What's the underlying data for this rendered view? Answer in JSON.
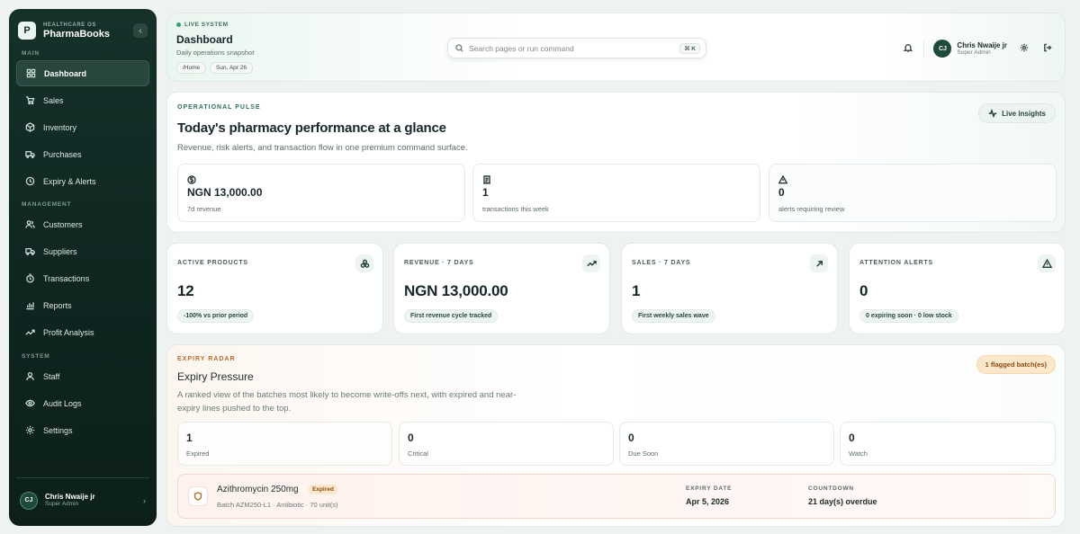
{
  "brand": {
    "sub": "HEALTHCARE OS",
    "name": "PharmaBooks",
    "logo": "P"
  },
  "sidebar": {
    "sections": {
      "main": "MAIN",
      "management": "MANAGEMENT",
      "system": "SYSTEM"
    },
    "items": [
      {
        "label": "Dashboard",
        "icon": "grid-icon",
        "active": true
      },
      {
        "label": "Sales",
        "icon": "cart-icon"
      },
      {
        "label": "Inventory",
        "icon": "box-icon"
      },
      {
        "label": "Purchases",
        "icon": "truck-icon"
      },
      {
        "label": "Expiry & Alerts",
        "icon": "clock-icon"
      },
      {
        "label": "Customers",
        "icon": "users-icon"
      },
      {
        "label": "Suppliers",
        "icon": "truck-icon"
      },
      {
        "label": "Transactions",
        "icon": "timer-icon"
      },
      {
        "label": "Reports",
        "icon": "bar-chart-icon"
      },
      {
        "label": "Profit Analysis",
        "icon": "trend-icon"
      },
      {
        "label": "Staff",
        "icon": "user-group-icon"
      },
      {
        "label": "Audit Logs",
        "icon": "eye-icon"
      },
      {
        "label": "Settings",
        "icon": "gear-icon"
      }
    ],
    "user": {
      "initials": "CJ",
      "name": "Chris Nwaije jr",
      "role": "Super Admin"
    }
  },
  "header": {
    "live": "LIVE SYSTEM",
    "title": "Dashboard",
    "subtitle": "Daily operations snapshot",
    "chips": [
      "/Home",
      "Sun, Apr 26"
    ],
    "search_placeholder": "Search pages or run command",
    "shortcut": "⌘ K",
    "user": {
      "initials": "CJ",
      "name": "Chris Nwaije jr",
      "role": "Super Admin"
    }
  },
  "pulse": {
    "eyebrow": "OPERATIONAL PULSE",
    "title": "Today's pharmacy performance at a glance",
    "subtitle": "Revenue, risk alerts, and transaction flow in one premium command surface.",
    "insights_label": "Live insights",
    "metrics": [
      {
        "value": "NGN 13,000.00",
        "label": "7d revenue",
        "icon": "coin-icon"
      },
      {
        "value": "1",
        "label": "transactions this week",
        "icon": "receipt-icon"
      },
      {
        "value": "0",
        "label": "alerts requiring review",
        "icon": "warning-icon"
      }
    ]
  },
  "stats": [
    {
      "label": "ACTIVE PRODUCTS",
      "value": "12",
      "note": "-100% vs prior period",
      "icon": "cubes-icon"
    },
    {
      "label": "REVENUE · 7 DAYS",
      "value": "NGN 13,000.00",
      "note": "First revenue cycle tracked",
      "icon": "trend-up-icon"
    },
    {
      "label": "SALES · 7 DAYS",
      "value": "1",
      "note": "First weekly sales wave",
      "icon": "arrow-up-right-icon"
    },
    {
      "label": "ATTENTION ALERTS",
      "value": "0",
      "note": "0 expiring soon · 0 low stock",
      "icon": "warning-icon"
    }
  ],
  "expiry": {
    "eyebrow": "EXPIRY RADAR",
    "title": "Expiry Pressure",
    "subtitle": "A ranked view of the batches most likely to become write-offs next, with expired and near-expiry lines pushed to the top.",
    "flag": "1 flagged batch(es)",
    "counts": [
      {
        "value": "1",
        "label": "Expired"
      },
      {
        "value": "0",
        "label": "Critical"
      },
      {
        "value": "0",
        "label": "Due Soon"
      },
      {
        "value": "0",
        "label": "Watch"
      }
    ],
    "batch": {
      "name": "Azithromycin 250mg",
      "badge": "Expired",
      "meta": "Batch AZM250-L1 · Antibiotic · 70 unit(s)",
      "expiry_label": "EXPIRY DATE",
      "expiry_value": "Apr 5, 2026",
      "countdown_label": "COUNTDOWN",
      "countdown_value": "21 day(s) overdue"
    }
  }
}
